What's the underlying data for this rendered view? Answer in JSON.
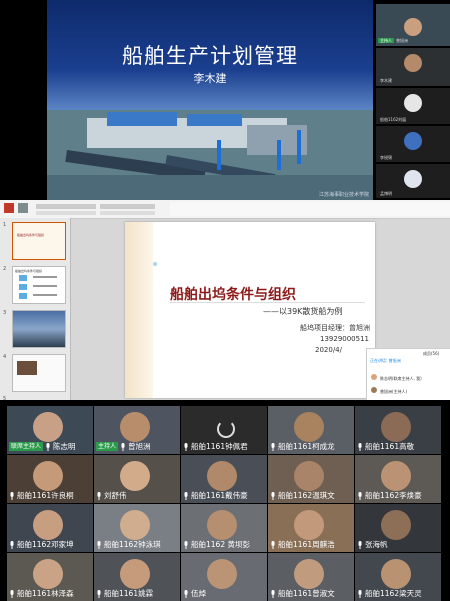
{
  "top_slide": {
    "title": "船舶生产计划管理",
    "author": "李木建",
    "footer": "江苏海事职业技术学院"
  },
  "side_participants": [
    {
      "name": "曾旭洲",
      "badge": "主持人"
    },
    {
      "name": "李木建",
      "badge": ""
    },
    {
      "name": "船舶1162刘展",
      "badge": ""
    },
    {
      "name": "李锐锦",
      "badge": ""
    },
    {
      "name": "孟博明",
      "badge": ""
    }
  ],
  "ppt": {
    "slide_numbers": [
      "1",
      "2",
      "3",
      "4",
      "5"
    ],
    "thumb1_title": "船舶出坞条件与组织",
    "thumb2_title": "船舶出坞条件与组织",
    "slide_title": "船舶出坞条件与组织",
    "subtitle": "——以39K散货船为例",
    "manager": "船坞项目经理：曾旭洲",
    "phone": "13929000511",
    "date": "2020/4/"
  },
  "chat": {
    "header": "成员(56)",
    "speaking": "正在讲话: 曾旭洲",
    "member1": "陈志明(联席主持人, 我)",
    "member2": "曾旭洲(主持人)"
  },
  "gallery": [
    {
      "name": "陈志明",
      "badge": "联席主持人"
    },
    {
      "name": "曾旭洲",
      "badge": "主持人"
    },
    {
      "name": "船舶1161钟佩君",
      "badge": ""
    },
    {
      "name": "船舶1161柯成龙",
      "badge": ""
    },
    {
      "name": "船舶1161高敬",
      "badge": ""
    },
    {
      "name": "船舶1161许良桐",
      "badge": ""
    },
    {
      "name": "刘舒伟",
      "badge": ""
    },
    {
      "name": "船舶1161戴伟豪",
      "badge": ""
    },
    {
      "name": "船舶1162温琪文",
      "badge": ""
    },
    {
      "name": "船舶1162李焕豪",
      "badge": ""
    },
    {
      "name": "船舶1162邓家坤",
      "badge": ""
    },
    {
      "name": "船舶1162钟泳琪",
      "badge": ""
    },
    {
      "name": "船舶1162 黄坝彭",
      "badge": ""
    },
    {
      "name": "船舶1161周麒浩",
      "badge": ""
    },
    {
      "name": "张海帆",
      "badge": ""
    },
    {
      "name": "船舶1161林泽森",
      "badge": ""
    },
    {
      "name": "船舶1161姚霖",
      "badge": ""
    },
    {
      "name": "伍焯",
      "badge": ""
    },
    {
      "name": "船舶1161曾淑文",
      "badge": ""
    },
    {
      "name": "船舶1162梁天灵",
      "badge": ""
    }
  ]
}
